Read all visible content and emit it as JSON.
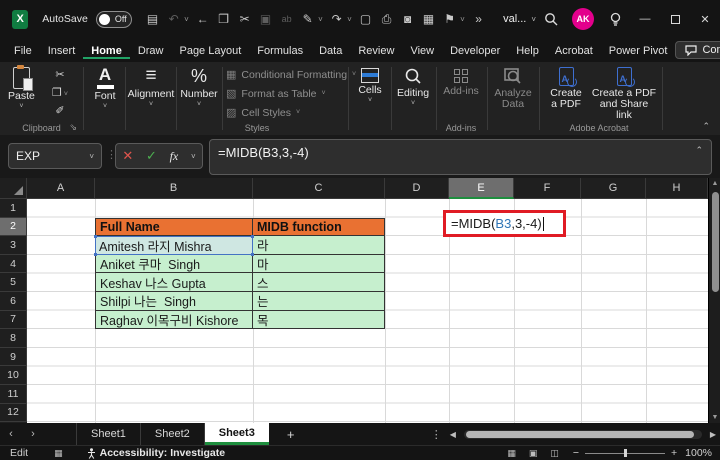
{
  "titlebar": {
    "app": "X",
    "autosave_label": "AutoSave",
    "autosave_state": "Off",
    "overflow": "»",
    "doc_title": "val...",
    "avatar": "AK"
  },
  "tabs": {
    "items": [
      "File",
      "Insert",
      "Home",
      "Draw",
      "Page Layout",
      "Formulas",
      "Data",
      "Review",
      "View",
      "Developer",
      "Help",
      "Acrobat",
      "Power Pivot"
    ],
    "active": "Home",
    "comments": "Comments"
  },
  "ribbon": {
    "paste": "Paste",
    "font": "Font",
    "alignment": "Alignment",
    "number": "Number",
    "conditional_formatting": "Conditional Formatting",
    "format_as_table": "Format as Table",
    "cell_styles": "Cell Styles",
    "cells": "Cells",
    "editing": "Editing",
    "addins_button": "Add-ins",
    "analyze_data_1": "Analyze",
    "analyze_data_2": "Data",
    "create_pdf_1": "Create",
    "create_pdf_2": "a PDF",
    "create_pdf_share_1": "Create a PDF",
    "create_pdf_share_2": "and Share link",
    "groups": {
      "clipboard": "Clipboard",
      "styles": "Styles",
      "addins": "Add-ins",
      "acrobat": "Adobe Acrobat"
    }
  },
  "formula_bar": {
    "name_box": "EXP",
    "fx": "fx",
    "formula": "=MIDB(B3,3,-4)"
  },
  "grid": {
    "columns": [
      "A",
      "B",
      "C",
      "D",
      "E",
      "F",
      "G",
      "H"
    ],
    "selected_column": "E",
    "rows": [
      "1",
      "2",
      "3",
      "4",
      "5",
      "6",
      "7",
      "8",
      "9",
      "10",
      "11",
      "12"
    ],
    "selected_row": "2",
    "table": {
      "headers": [
        "Full Name",
        "MIDB function"
      ],
      "rows": [
        [
          "Amitesh 라지 Mishra",
          "라"
        ],
        [
          "Aniket 쿠마  Singh",
          "마"
        ],
        [
          "Keshav 나스 Gupta",
          "스"
        ],
        [
          "Shilpi 나는  Singh",
          "는"
        ],
        [
          "Raghav 이목구비 Kishore",
          "목"
        ]
      ]
    },
    "edit_cell": {
      "pre": "=MIDB(",
      "ref": "B3",
      "post": ",3,-4)"
    }
  },
  "sheetbar": {
    "sheets": [
      "Sheet1",
      "Sheet2",
      "Sheet3"
    ],
    "active": "Sheet3"
  },
  "statusbar": {
    "mode": "Edit",
    "accessibility": "Accessibility: Investigate",
    "zoom": "100%"
  },
  "colors": {
    "accent_green": "#21A366",
    "header_orange": "#E97132",
    "cell_green": "#C6EFCE",
    "ref_blue": "#4472C4",
    "annotation_red": "#E01B24",
    "avatar_pink": "#E3008C"
  }
}
